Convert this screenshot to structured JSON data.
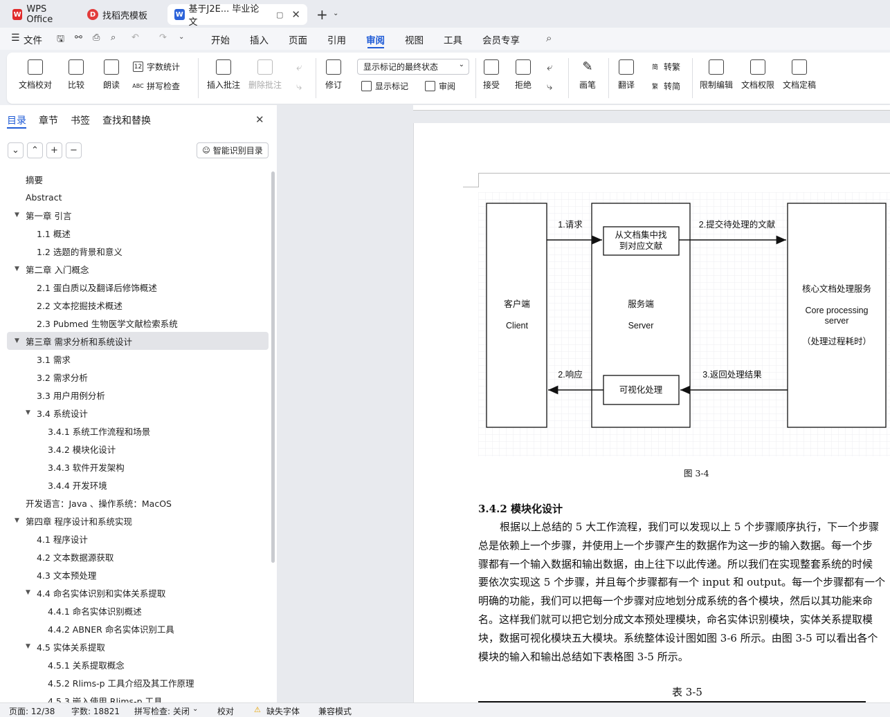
{
  "tabs": [
    {
      "label": "WPS Office",
      "icon": "wps-logo-icon",
      "color": "#e02b2b"
    },
    {
      "label": "找稻壳模板",
      "icon": "docer-icon",
      "color": "#e23b3b"
    },
    {
      "label": "基于J2E... 毕业论文",
      "icon": "word-doc-icon",
      "color": "#2b62d9"
    }
  ],
  "menu": {
    "file": "文件",
    "items": [
      "开始",
      "插入",
      "页面",
      "引用",
      "审阅",
      "视图",
      "工具",
      "会员专享"
    ],
    "active": "审阅"
  },
  "ribbon": {
    "doc_check": "文档校对",
    "compare": "比较",
    "read_aloud": "朗读",
    "word_count": "字数统计",
    "spell_check": "拼写检查",
    "insert_comment": "插入批注",
    "delete_comment": "删除批注",
    "revise": "修订",
    "display_select": "显示标记的最终状态",
    "show_markup": "显示标记",
    "review": "审阅",
    "accept": "接受",
    "reject": "拒绝",
    "pen": "画笔",
    "translate": "翻译",
    "to_traditional": "转繁",
    "to_simplified": "转简",
    "restrict_edit": "限制编辑",
    "doc_permission": "文档权限",
    "doc_finalize": "文档定稿"
  },
  "sidebar": {
    "tabs": [
      "目录",
      "章节",
      "书签",
      "查找和替换"
    ],
    "active_tab": "目录",
    "smart_button": "智能识别目录",
    "toc": [
      {
        "label": "摘要",
        "level": 0,
        "arrow": ""
      },
      {
        "label": "Abstract",
        "level": 0,
        "arrow": ""
      },
      {
        "label": "第一章  引言",
        "level": 0,
        "arrow": "▼"
      },
      {
        "label": "1.1  概述",
        "level": 1,
        "arrow": ""
      },
      {
        "label": "1.2  选题的背景和意义",
        "level": 1,
        "arrow": ""
      },
      {
        "label": "第二章  入门概念",
        "level": 0,
        "arrow": "▼"
      },
      {
        "label": "2.1  蛋白质以及翻译后修饰概述",
        "level": 1,
        "arrow": ""
      },
      {
        "label": "2.2 文本挖掘技术概述",
        "level": 1,
        "arrow": ""
      },
      {
        "label": "2.3 Pubmed 生物医学文献检索系统",
        "level": 1,
        "arrow": ""
      },
      {
        "label": "第三章  需求分析和系统设计",
        "level": 0,
        "arrow": "▼",
        "selected": true
      },
      {
        "label": "3.1 需求",
        "level": 1,
        "arrow": ""
      },
      {
        "label": "3.2  需求分析",
        "level": 1,
        "arrow": ""
      },
      {
        "label": "3.3  用户用例分析",
        "level": 1,
        "arrow": ""
      },
      {
        "label": "3.4  系统设计",
        "level": 1,
        "arrow": "▼"
      },
      {
        "label": "3.4.1  系统工作流程和场景",
        "level": 2,
        "arrow": ""
      },
      {
        "label": "3.4.2  模块化设计",
        "level": 2,
        "arrow": ""
      },
      {
        "label": "3.4.3  软件开发架构",
        "level": 2,
        "arrow": ""
      },
      {
        "label": "3.4.4  开发环境",
        "level": 2,
        "arrow": ""
      },
      {
        "label": "开发语言：Java 、操作系统：MacOS",
        "level": 0,
        "arrow": ""
      },
      {
        "label": "第四章  程序设计和系统实现",
        "level": 0,
        "arrow": "▼"
      },
      {
        "label": "4.1  程序设计",
        "level": 1,
        "arrow": ""
      },
      {
        "label": "4.2  文本数据源获取",
        "level": 1,
        "arrow": ""
      },
      {
        "label": "4.3  文本预处理",
        "level": 1,
        "arrow": ""
      },
      {
        "label": "4.4  命名实体识别和实体关系提取",
        "level": 1,
        "arrow": "▼"
      },
      {
        "label": "4.4.1 命名实体识别概述",
        "level": 2,
        "arrow": ""
      },
      {
        "label": "4.4.2 ABNER 命名实体识别工具",
        "level": 2,
        "arrow": ""
      },
      {
        "label": "4.5  实体关系提取",
        "level": 1,
        "arrow": "▼"
      },
      {
        "label": "4.5.1  关系提取概念",
        "level": 2,
        "arrow": ""
      },
      {
        "label": "4.5.2 Rlims-p 工具介绍及其工作原理",
        "level": 2,
        "arrow": ""
      },
      {
        "label": "4.5.3  嵌入使用 Rlims-p 工具",
        "level": 2,
        "arrow": ""
      }
    ]
  },
  "diagram": {
    "client": [
      "客户端",
      "Client"
    ],
    "server": [
      "服务端",
      "Server"
    ],
    "core": [
      "核心文档处理服务",
      "Core processing",
      "server",
      "（处理过程耗时）"
    ],
    "find_doc": [
      "从文档集中找",
      "到对应文献"
    ],
    "visualize": "可视化处理",
    "arrow_request": "1.请求",
    "arrow_submit": "2.提交待处理的文献",
    "arrow_response": "2.响应",
    "arrow_return": "3.返回处理结果",
    "caption": "图 3-4"
  },
  "document": {
    "heading": "3.4.2  模块化设计",
    "lines": [
      "根据以上总结的 5 大工作流程，我们可以发现以上 5 个步骤顺序执行，下一个步骤",
      "总是依赖上一个步骤，并使用上一个步骤产生的数据作为这一步的输入数据。每一个步",
      "骤都有一个输入数据和输出数据，由上往下以此传递。所以我们在实现整套系统的时候",
      "要依次实现这 5 个步骤，并且每个步骤都有一个 input 和 output。每一个步骤都有一个",
      "明确的功能，我们可以把每一个步骤对应地划分成系统的各个模块，然后以其功能来命",
      "名。这样我们就可以把它划分成文本预处理模块，命名实体识别模块，实体关系提取模",
      "块，数据可视化模块五大模块。系统整体设计图如图 3-6 所示。由图 3-5 可以看出各个",
      "模块的输入和输出总结如下表格图 3-5 所示。"
    ],
    "table_caption": "表 3-5"
  },
  "status": {
    "page": "页面: 12/38",
    "words": "字数: 18821",
    "spell": "拼写检查: 关闭",
    "proof": "校对",
    "missing_font": "缺失字体",
    "compat": "兼容模式"
  }
}
